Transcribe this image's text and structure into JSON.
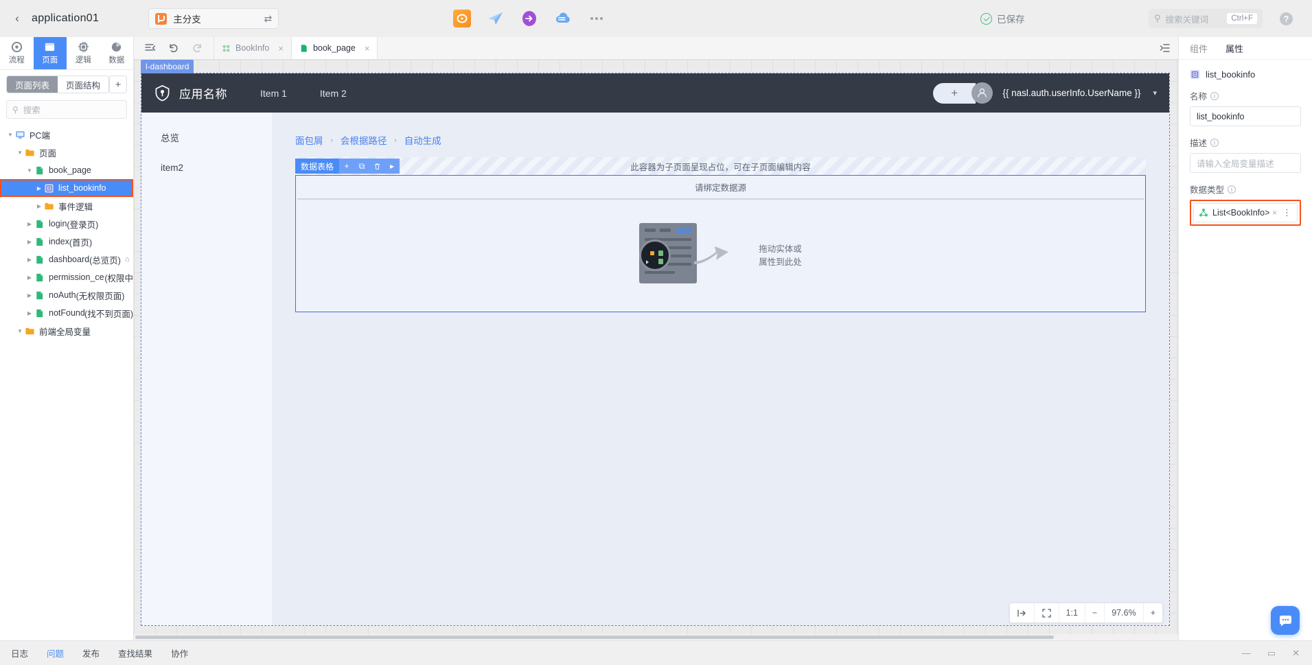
{
  "topbar": {
    "back_icon": "chevron-left-icon",
    "app_title": "application01",
    "branch": {
      "icon": "branch-icon",
      "label": "主分支",
      "swap_icon": "swap-icon"
    },
    "tools": [
      {
        "name": "preview-icon",
        "title": "预览"
      },
      {
        "name": "send-icon",
        "title": "发送"
      },
      {
        "name": "deploy-icon",
        "title": "部署"
      },
      {
        "name": "cloud-data-icon",
        "title": "数据源"
      },
      {
        "name": "more-icon",
        "title": "更多"
      }
    ],
    "saved_text": "已保存",
    "saved_color": "#4cbd87",
    "search": {
      "placeholder": "搜索关键词",
      "shortcut": "Ctrl+F",
      "icon": "search-icon"
    },
    "help_icon": "help-icon",
    "help_glyph": "?"
  },
  "rail": {
    "items": [
      {
        "label": "流程",
        "icon": "flow-icon",
        "active": false
      },
      {
        "label": "页面",
        "icon": "page-icon",
        "active": true
      },
      {
        "label": "逻辑",
        "icon": "logic-icon",
        "active": false
      },
      {
        "label": "数据",
        "icon": "data-icon",
        "active": false
      }
    ],
    "active_color": "#4a8cf7"
  },
  "left_panel": {
    "tab_list": "页面列表",
    "tab_structure": "页面结构",
    "add_button": "+",
    "search_placeholder": "搜索",
    "tree": [
      {
        "label": "PC端",
        "suffix": "",
        "depth": 0,
        "caret": "down",
        "icon": "monitor-icon",
        "selected": false
      },
      {
        "label": "页面",
        "suffix": "",
        "depth": 1,
        "caret": "down",
        "icon": "folder-icon",
        "selected": false
      },
      {
        "label": "book_page",
        "suffix": "",
        "depth": 2,
        "caret": "down",
        "icon": "page-file-icon",
        "selected": false
      },
      {
        "label": "list_bookinfo",
        "suffix": "",
        "depth": 3,
        "caret": "right",
        "icon": "variable-icon",
        "selected": true,
        "highlight_box": true
      },
      {
        "label": "事件逻辑",
        "suffix": "",
        "depth": 3,
        "caret": "right",
        "icon": "folder-icon",
        "selected": false
      },
      {
        "label": "login",
        "suffix": " (登录页)",
        "depth": 2,
        "caret": "right",
        "icon": "page-file-icon",
        "selected": false
      },
      {
        "label": "index",
        "suffix": " (首页)",
        "depth": 2,
        "caret": "right",
        "icon": "page-file-icon",
        "selected": false
      },
      {
        "label": "dashboard",
        "suffix": " (总览页)",
        "depth": 2,
        "caret": "right",
        "icon": "page-file-icon",
        "selected": false,
        "home": true
      },
      {
        "label": "permission_center",
        "suffix": " (权限中",
        "depth": 2,
        "caret": "right",
        "icon": "page-file-icon",
        "selected": false
      },
      {
        "label": "noAuth",
        "suffix": " (无权限页面)",
        "depth": 2,
        "caret": "right",
        "icon": "page-file-icon",
        "selected": false
      },
      {
        "label": "notFound",
        "suffix": " (找不到页面)",
        "depth": 2,
        "caret": "right",
        "icon": "page-file-icon",
        "selected": false
      },
      {
        "label": "前端全局变量",
        "suffix": "",
        "depth": 1,
        "caret": "down",
        "icon": "folder-icon",
        "selected": false
      }
    ]
  },
  "editor": {
    "tools": [
      {
        "name": "outline-toggle-icon",
        "glyph": "≡◂"
      },
      {
        "name": "undo-icon",
        "glyph": "↶"
      },
      {
        "name": "redo-icon",
        "glyph": "↷"
      }
    ],
    "tabs": [
      {
        "label": "BookInfo",
        "icon": "entity-icon",
        "active": false,
        "close": "×"
      },
      {
        "label": "book_page",
        "icon": "page-file-icon",
        "active": true,
        "close": "×"
      }
    ],
    "collapse_right_icon": "collapse-panel-icon"
  },
  "canvas": {
    "layout_badge": "l-dashboard",
    "app_header": {
      "logo_icon": "shield-logo-icon",
      "app_name": "应用名称",
      "nav": [
        "Item 1",
        "Item 2"
      ],
      "add_glyph": "+",
      "avatar_icon": "user-avatar-icon",
      "username_expression": "{{ nasl.auth.userInfo.UserName }}",
      "chevron": "▾"
    },
    "side_menu": [
      "总览",
      "item2"
    ],
    "breadcrumb": [
      "面包屑",
      "会根据路径",
      "自动生成"
    ],
    "breadcrumb_separator": "›",
    "slot": {
      "tag": "数据表格",
      "tools": [
        "+",
        "⧉",
        "Ὕ1",
        "▸"
      ],
      "hint": "此容器为子页面呈现占位，可在子页面编辑内容"
    },
    "table": {
      "bind_hint": "请绑定数据源",
      "drop_hint_line1": "拖动实体或",
      "drop_hint_line2": "属性到此处"
    },
    "zoom_bar": {
      "fit_width_icon": "fit-width-icon",
      "fit_screen_icon": "fit-screen-icon",
      "ratio_label": "1:1",
      "minus": "−",
      "zoom_value": "97.6%",
      "plus": "+"
    }
  },
  "right_panel": {
    "tab_component": "组件",
    "tab_property": "属性",
    "header_icon": "variable-icon",
    "header_name": "list_bookinfo",
    "name_label": "名称",
    "name_value": "list_bookinfo",
    "desc_label": "描述",
    "desc_placeholder": "请输入全局变量描述",
    "type_label": "数据类型",
    "type_value": "List<BookInfo>",
    "type_icon": "type-struct-icon",
    "clear_glyph": "×",
    "more_glyph": "⋮",
    "highlight_color": "#f4511e"
  },
  "bottombar": {
    "items": [
      {
        "label": "日志",
        "active": false
      },
      {
        "label": "问题",
        "active": true
      },
      {
        "label": "发布",
        "active": false
      },
      {
        "label": "查找结果",
        "active": false
      },
      {
        "label": "协作",
        "active": false
      }
    ],
    "window_controls": [
      "—",
      "▭",
      "✕"
    ],
    "chat_icon": "chat-bubble-icon"
  }
}
